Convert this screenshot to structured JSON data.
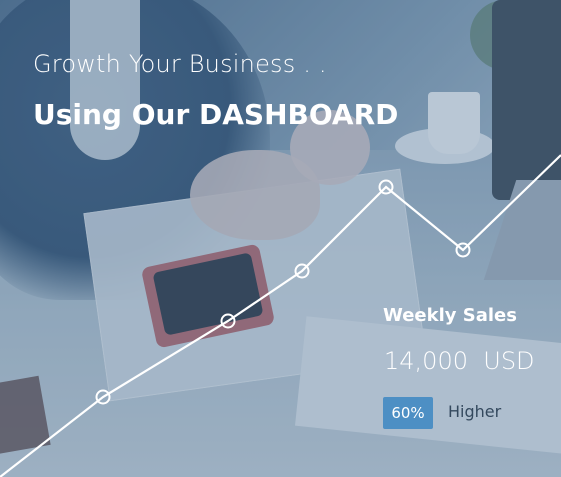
{
  "hero": {
    "tagline": "Growth Your Business . .",
    "headline": "Using Our DASHBOARD"
  },
  "sales_card": {
    "title": "Weekly Sales",
    "amount": "14,000",
    "currency": "USD",
    "change_badge": "60%",
    "change_label": "Higher",
    "badge_color": "#4d8fc4"
  },
  "trend_line": {
    "color": "#ffffff",
    "point_count": 5
  }
}
